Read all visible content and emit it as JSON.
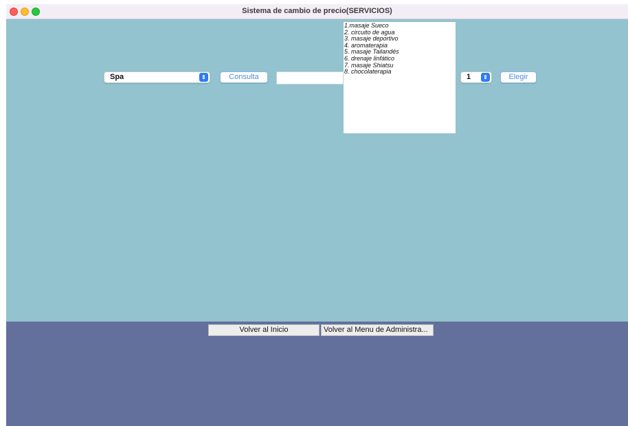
{
  "window": {
    "title": "Sistema de cambio de precio(SERVICIOS)"
  },
  "form": {
    "category_select": {
      "value": "Spa"
    },
    "consulta_label": "Consulta",
    "text_input": {
      "value": ""
    },
    "services_list": [
      "1.masaje Sueco",
      "2. circuito de agua",
      "3. masaje deportivo",
      "4. aromaterapia",
      "5. masaje Tailandés",
      "6. drenaje linfático",
      "7. masaje Shiatsu",
      "8. chocolaterapia"
    ],
    "number_select": {
      "value": "1"
    },
    "elegir_label": "Elegir"
  },
  "footer": {
    "volver_inicio_label": "Volver al Inicio",
    "volver_menu_label": "Volver al Menu de Administra..."
  },
  "colors": {
    "content_bg": "#92c3ce",
    "bottom_bg": "#63709b",
    "accent": "#2d7cf6"
  },
  "icons": {
    "close": "close-icon",
    "minimize": "minimize-icon",
    "maximize": "maximize-icon",
    "stepper": "up-down-chevron-icon"
  }
}
